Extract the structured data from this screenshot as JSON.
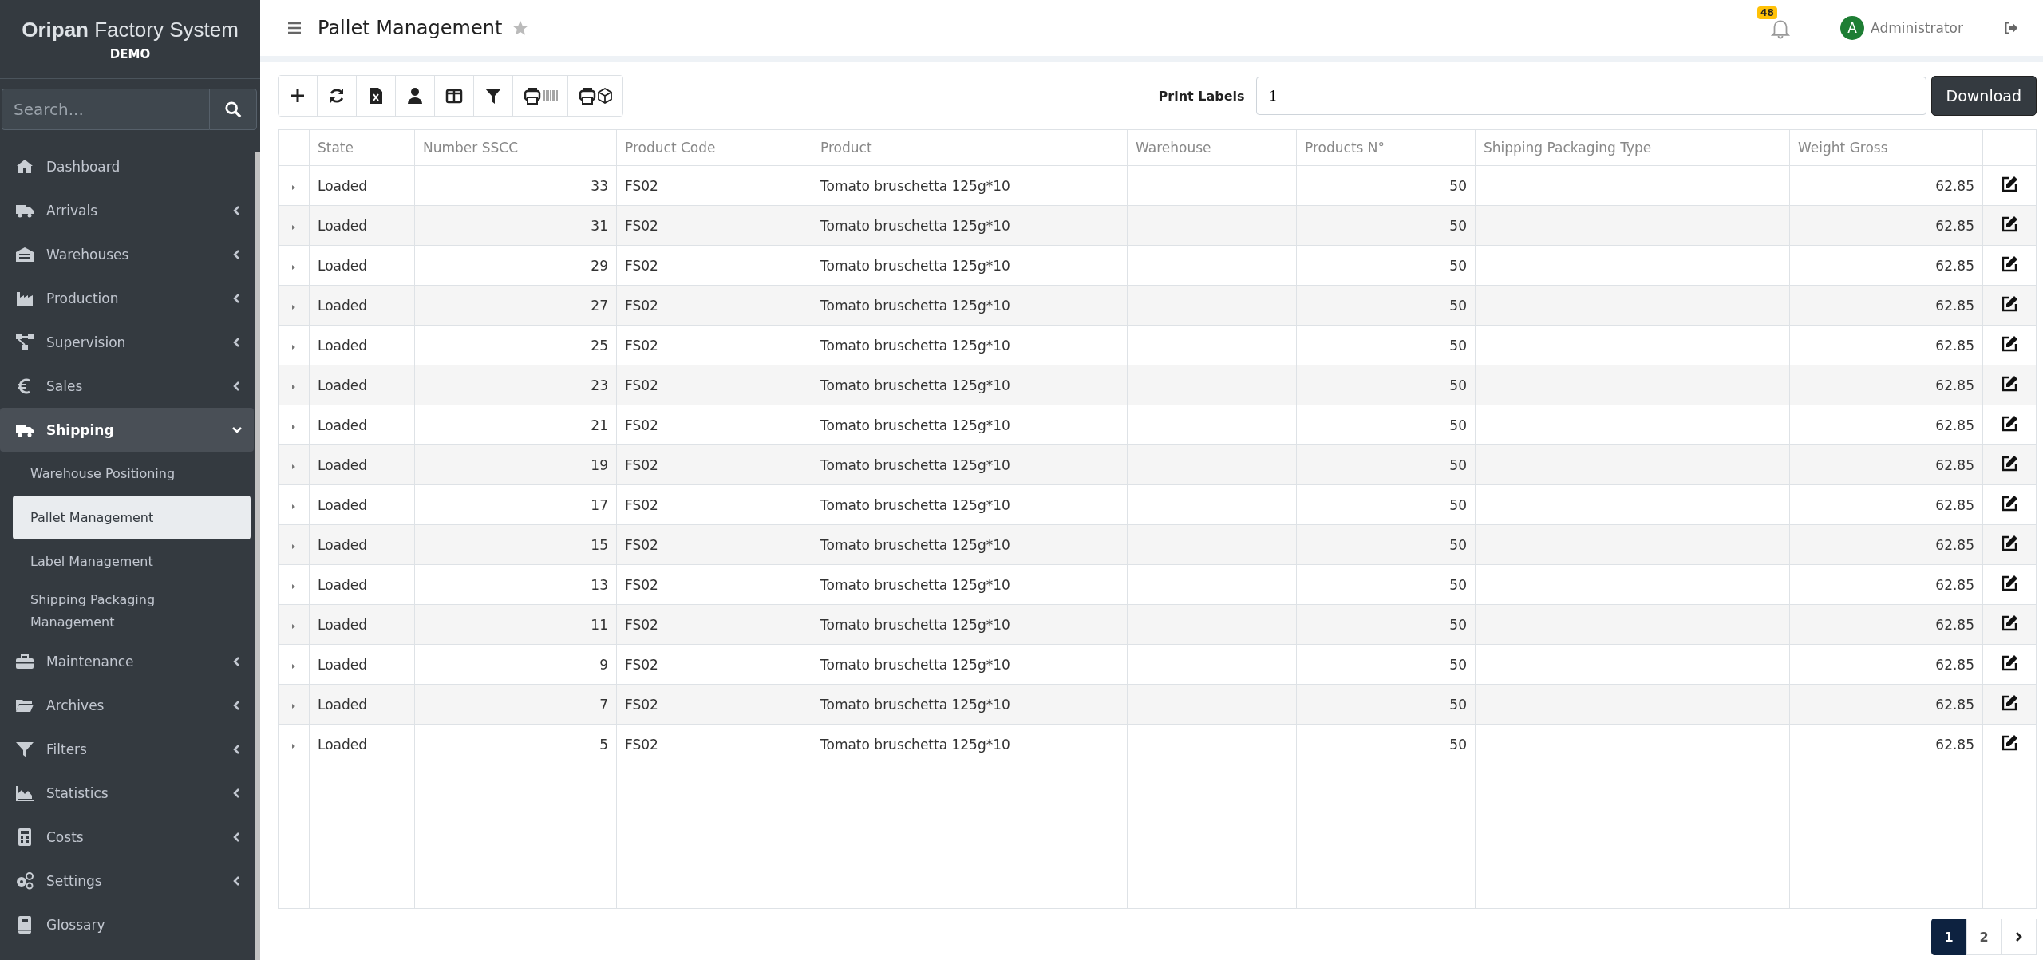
{
  "brand": {
    "name_bold": "Oripan",
    "name_rest": "Factory System",
    "subtitle": "DEMO"
  },
  "sidebar": {
    "search": {
      "placeholder": "Search..."
    },
    "items": [
      {
        "kind": "link",
        "label": "Dashboard"
      },
      {
        "kind": "group",
        "label": "Arrivals",
        "expanded": false
      },
      {
        "kind": "group",
        "label": "Warehouses",
        "expanded": false
      },
      {
        "kind": "group",
        "label": "Production",
        "expanded": false
      },
      {
        "kind": "group",
        "label": "Supervision",
        "expanded": false
      },
      {
        "kind": "group",
        "label": "Sales",
        "expanded": false
      },
      {
        "kind": "group",
        "label": "Shipping",
        "expanded": true,
        "children": [
          {
            "label": "Warehouse Positioning",
            "selected": false
          },
          {
            "label": "Pallet Management",
            "selected": true
          },
          {
            "label": "Label Management",
            "selected": false
          },
          {
            "label": "Shipping Packaging Management",
            "selected": false
          }
        ]
      },
      {
        "kind": "group",
        "label": "Maintenance",
        "expanded": false
      },
      {
        "kind": "group",
        "label": "Archives",
        "expanded": false
      },
      {
        "kind": "group",
        "label": "Filters",
        "expanded": false
      },
      {
        "kind": "group",
        "label": "Statistics",
        "expanded": false
      },
      {
        "kind": "group",
        "label": "Costs",
        "expanded": false
      },
      {
        "kind": "group",
        "label": "Settings",
        "expanded": false
      },
      {
        "kind": "link",
        "label": "Glossary"
      }
    ]
  },
  "header": {
    "title": "Pallet Management",
    "notifications": "48",
    "avatar_letter": "A",
    "user": "Administrator"
  },
  "toolbar": {
    "print_labels_label": "Print Labels",
    "print_labels_value": "1",
    "download": "Download"
  },
  "table": {
    "columns": [
      "State",
      "Number SSCC",
      "Product Code",
      "Product",
      "Warehouse",
      "Products N°",
      "Shipping Packaging Type",
      "Weight Gross"
    ],
    "rows": [
      [
        "Loaded",
        "33",
        "FS02",
        "Tomato bruschetta 125g*10",
        "",
        "50",
        "",
        "62.85"
      ],
      [
        "Loaded",
        "31",
        "FS02",
        "Tomato bruschetta 125g*10",
        "",
        "50",
        "",
        "62.85"
      ],
      [
        "Loaded",
        "29",
        "FS02",
        "Tomato bruschetta 125g*10",
        "",
        "50",
        "",
        "62.85"
      ],
      [
        "Loaded",
        "27",
        "FS02",
        "Tomato bruschetta 125g*10",
        "",
        "50",
        "",
        "62.85"
      ],
      [
        "Loaded",
        "25",
        "FS02",
        "Tomato bruschetta 125g*10",
        "",
        "50",
        "",
        "62.85"
      ],
      [
        "Loaded",
        "23",
        "FS02",
        "Tomato bruschetta 125g*10",
        "",
        "50",
        "",
        "62.85"
      ],
      [
        "Loaded",
        "21",
        "FS02",
        "Tomato bruschetta 125g*10",
        "",
        "50",
        "",
        "62.85"
      ],
      [
        "Loaded",
        "19",
        "FS02",
        "Tomato bruschetta 125g*10",
        "",
        "50",
        "",
        "62.85"
      ],
      [
        "Loaded",
        "17",
        "FS02",
        "Tomato bruschetta 125g*10",
        "",
        "50",
        "",
        "62.85"
      ],
      [
        "Loaded",
        "15",
        "FS02",
        "Tomato bruschetta 125g*10",
        "",
        "50",
        "",
        "62.85"
      ],
      [
        "Loaded",
        "13",
        "FS02",
        "Tomato bruschetta 125g*10",
        "",
        "50",
        "",
        "62.85"
      ],
      [
        "Loaded",
        "11",
        "FS02",
        "Tomato bruschetta 125g*10",
        "",
        "50",
        "",
        "62.85"
      ],
      [
        "Loaded",
        "9",
        "FS02",
        "Tomato bruschetta 125g*10",
        "",
        "50",
        "",
        "62.85"
      ],
      [
        "Loaded",
        "7",
        "FS02",
        "Tomato bruschetta 125g*10",
        "",
        "50",
        "",
        "62.85"
      ],
      [
        "Loaded",
        "5",
        "FS02",
        "Tomato bruschetta 125g*10",
        "",
        "50",
        "",
        "62.85"
      ]
    ]
  },
  "pagination": [
    {
      "label": "1",
      "selected": true
    },
    {
      "label": "2",
      "selected": false
    }
  ]
}
